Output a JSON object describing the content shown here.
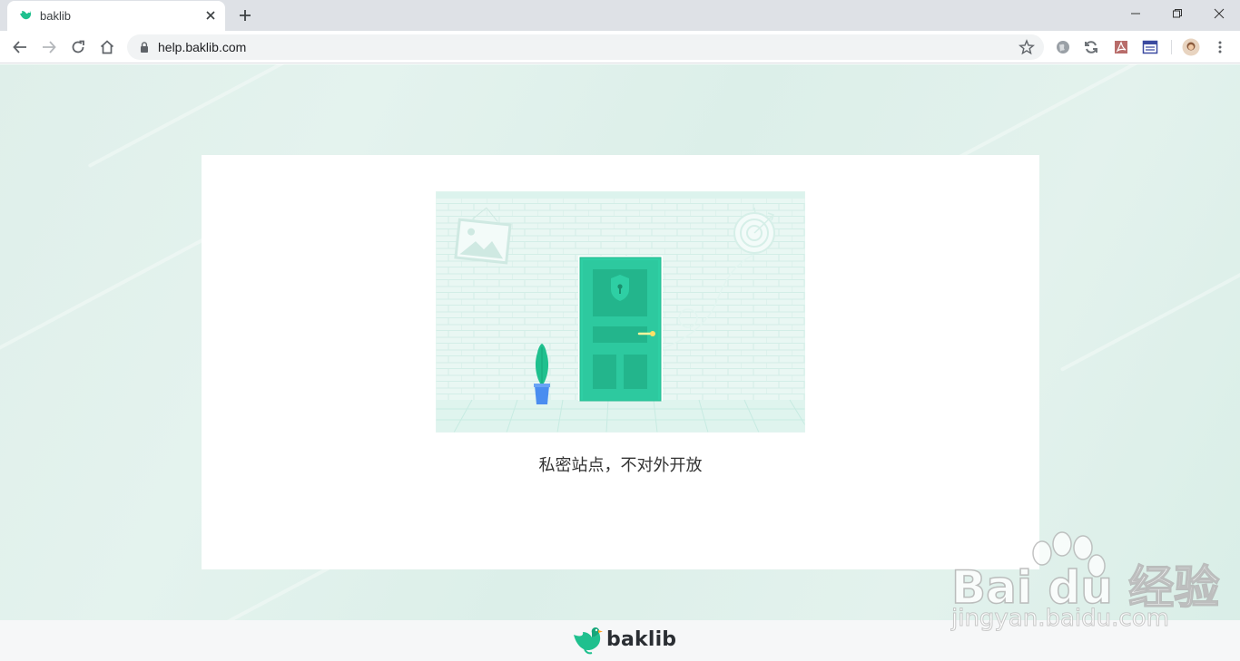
{
  "browser": {
    "tab": {
      "title": "baklib",
      "favicon": "baklib-bird-icon"
    },
    "address": {
      "url": "help.baklib.com"
    },
    "toolbar_icons": [
      "back-icon",
      "forward-icon",
      "reload-icon",
      "home-icon",
      "lock-icon",
      "star-icon",
      "globe-extension-icon",
      "sync-extension-icon",
      "pdf-extension-icon",
      "reader-extension-icon",
      "avatar",
      "menu-icon"
    ],
    "window_controls": [
      "minimize-icon",
      "restore-icon",
      "close-icon"
    ]
  },
  "page": {
    "message": "私密站点，不对外开放",
    "footer": {
      "brand": "baklib"
    }
  },
  "watermark": {
    "main": "Bai du 经验",
    "sub": "jingyan.baidu.com"
  },
  "colors": {
    "accent": "#2ecc9f",
    "page_bg": "#dfefea",
    "door": "#2ecfa4",
    "pot": "#4a8df0"
  }
}
